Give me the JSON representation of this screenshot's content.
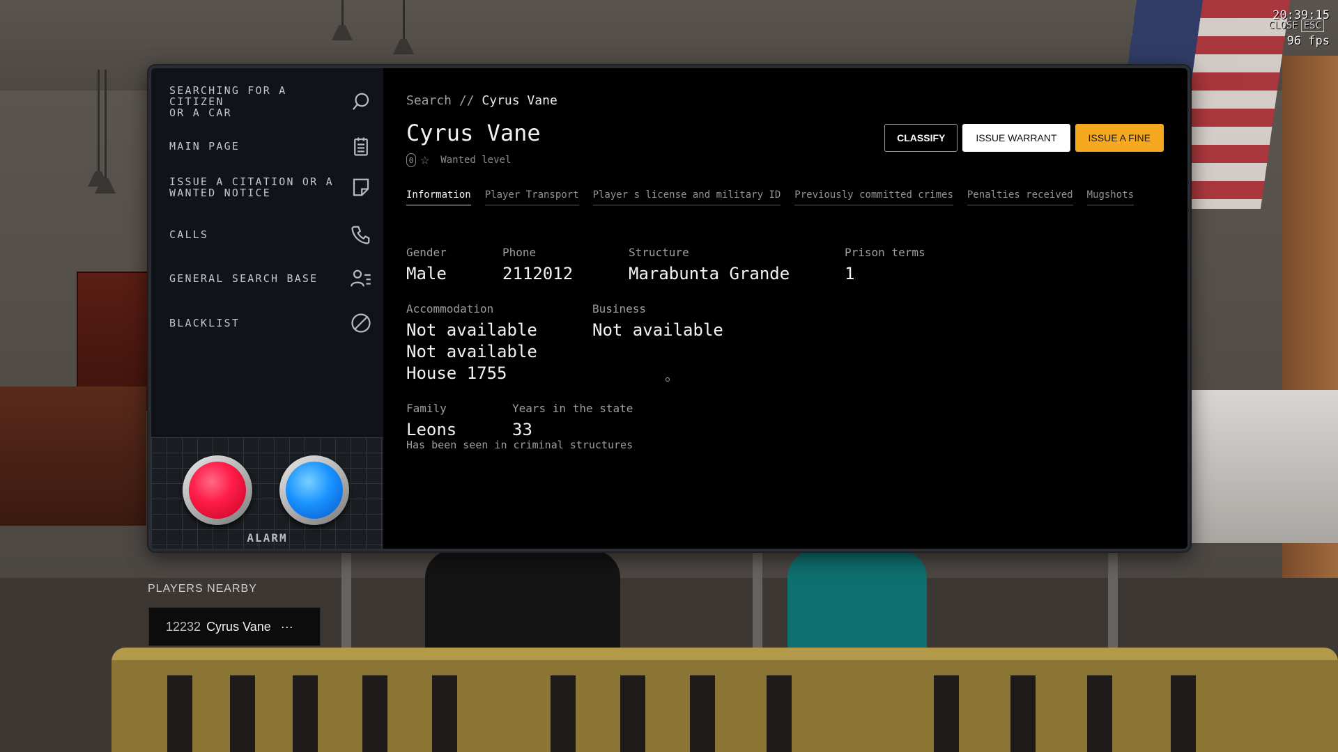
{
  "hud": {
    "time": "20:39:15",
    "fps": "96 fps",
    "close_label": "CLOSE",
    "close_key": "ESC"
  },
  "sidebar": {
    "items": [
      {
        "label": "SEARCHING FOR A\nCITIZEN\nOR A CAR",
        "icon": "search-icon"
      },
      {
        "label": "MAIN PAGE",
        "icon": "clipboard-icon"
      },
      {
        "label": "ISSUE A CITATION OR A\nWANTED NOTICE",
        "icon": "note-icon"
      },
      {
        "label": "CALLS",
        "icon": "phone-icon"
      },
      {
        "label": "GENERAL SEARCH BASE",
        "icon": "people-list-icon"
      },
      {
        "label": "BLACKLIST",
        "icon": "block-icon"
      }
    ],
    "alarm_label": "ALARM"
  },
  "breadcrumb": {
    "root": "Search",
    "separator": "//",
    "current": "Cyrus Vane"
  },
  "profile": {
    "name": "Cyrus Vane",
    "wanted_value": "0",
    "wanted_label": "Wanted level"
  },
  "actions": {
    "classify": "CLASSIFY",
    "warrant": "ISSUE WARRANT",
    "fine": "ISSUE A FINE"
  },
  "tabs": [
    "Information",
    "Player Transport",
    "Player s license and military ID",
    "Previously committed crimes",
    "Penalties received",
    "Mugshots"
  ],
  "info": {
    "gender": {
      "label": "Gender",
      "value": "Male"
    },
    "phone": {
      "label": "Phone",
      "value": "2112012"
    },
    "structure": {
      "label": "Structure",
      "value": "Marabunta Grande"
    },
    "prison": {
      "label": "Prison terms",
      "value": "1"
    },
    "accommodation": {
      "label": "Accommodation",
      "values": [
        "Not available",
        "Not available",
        "House 1755"
      ]
    },
    "business": {
      "label": "Business",
      "value": "Not available"
    },
    "family": {
      "label": "Family",
      "value": "Leons"
    },
    "years": {
      "label": "Years in the state",
      "value": "33"
    },
    "note": "Has been seen in criminal structures"
  },
  "nearby": {
    "title": "PLAYERS NEARBY",
    "players": [
      {
        "id": "12232",
        "name": "Cyrus Vane",
        "more": "···"
      }
    ]
  },
  "colors": {
    "accent": "#f6a81f",
    "panel": "#000000",
    "sidebar": "#101418"
  }
}
